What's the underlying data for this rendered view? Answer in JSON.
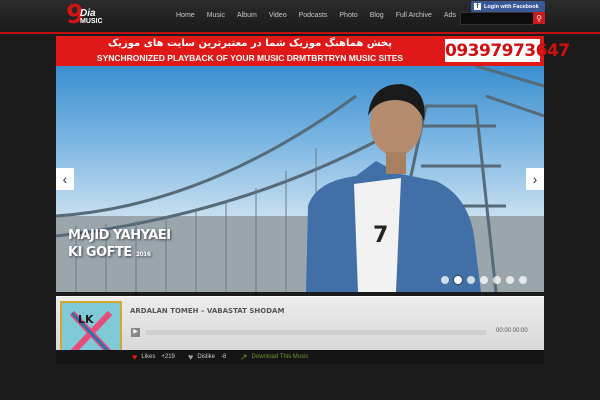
{
  "logo": {
    "digit": "9",
    "word": "Dia",
    "sub": "MUSIC"
  },
  "nav": [
    {
      "label": "Home"
    },
    {
      "label": "Music"
    },
    {
      "label": "Album"
    },
    {
      "label": "Video"
    },
    {
      "label": "Podcasts"
    },
    {
      "label": "Photo"
    },
    {
      "label": "Blog"
    },
    {
      "label": "Full Archive"
    },
    {
      "label": "Ads"
    }
  ],
  "header": {
    "facebook_label": "Login with Facebook",
    "search_placeholder": ""
  },
  "banner": {
    "persian_text": "پخش هماهنگ موزیک شما در معتبرترین سایت های موزیک",
    "english_text": "SYNCHRONIZED PLAYBACK OF YOUR MUSIC DRMTBRTRYN MUSIC SITES",
    "phone": "09397973647"
  },
  "slider": {
    "artist": "MAJID YAHYAEI",
    "song": "KI GOFTE",
    "year": "2016",
    "prev": "‹",
    "next": "›",
    "dot_count": 7,
    "active_dot": 1
  },
  "player": {
    "track_title": "ARDALAN TOMEH – VABASTAT SHODAM",
    "time": "00:00  00:00",
    "cover_text": "LK"
  },
  "stats": {
    "likes_label": "Likes",
    "likes_count": "+219",
    "dislike_label": "Dislike",
    "dislike_count": "-8",
    "download_label": "Download This Music"
  },
  "colors": {
    "accent_red": "#e01818",
    "facebook_blue": "#3b5998",
    "cover_border": "#d4a830",
    "download_green": "#6c9a2c"
  }
}
